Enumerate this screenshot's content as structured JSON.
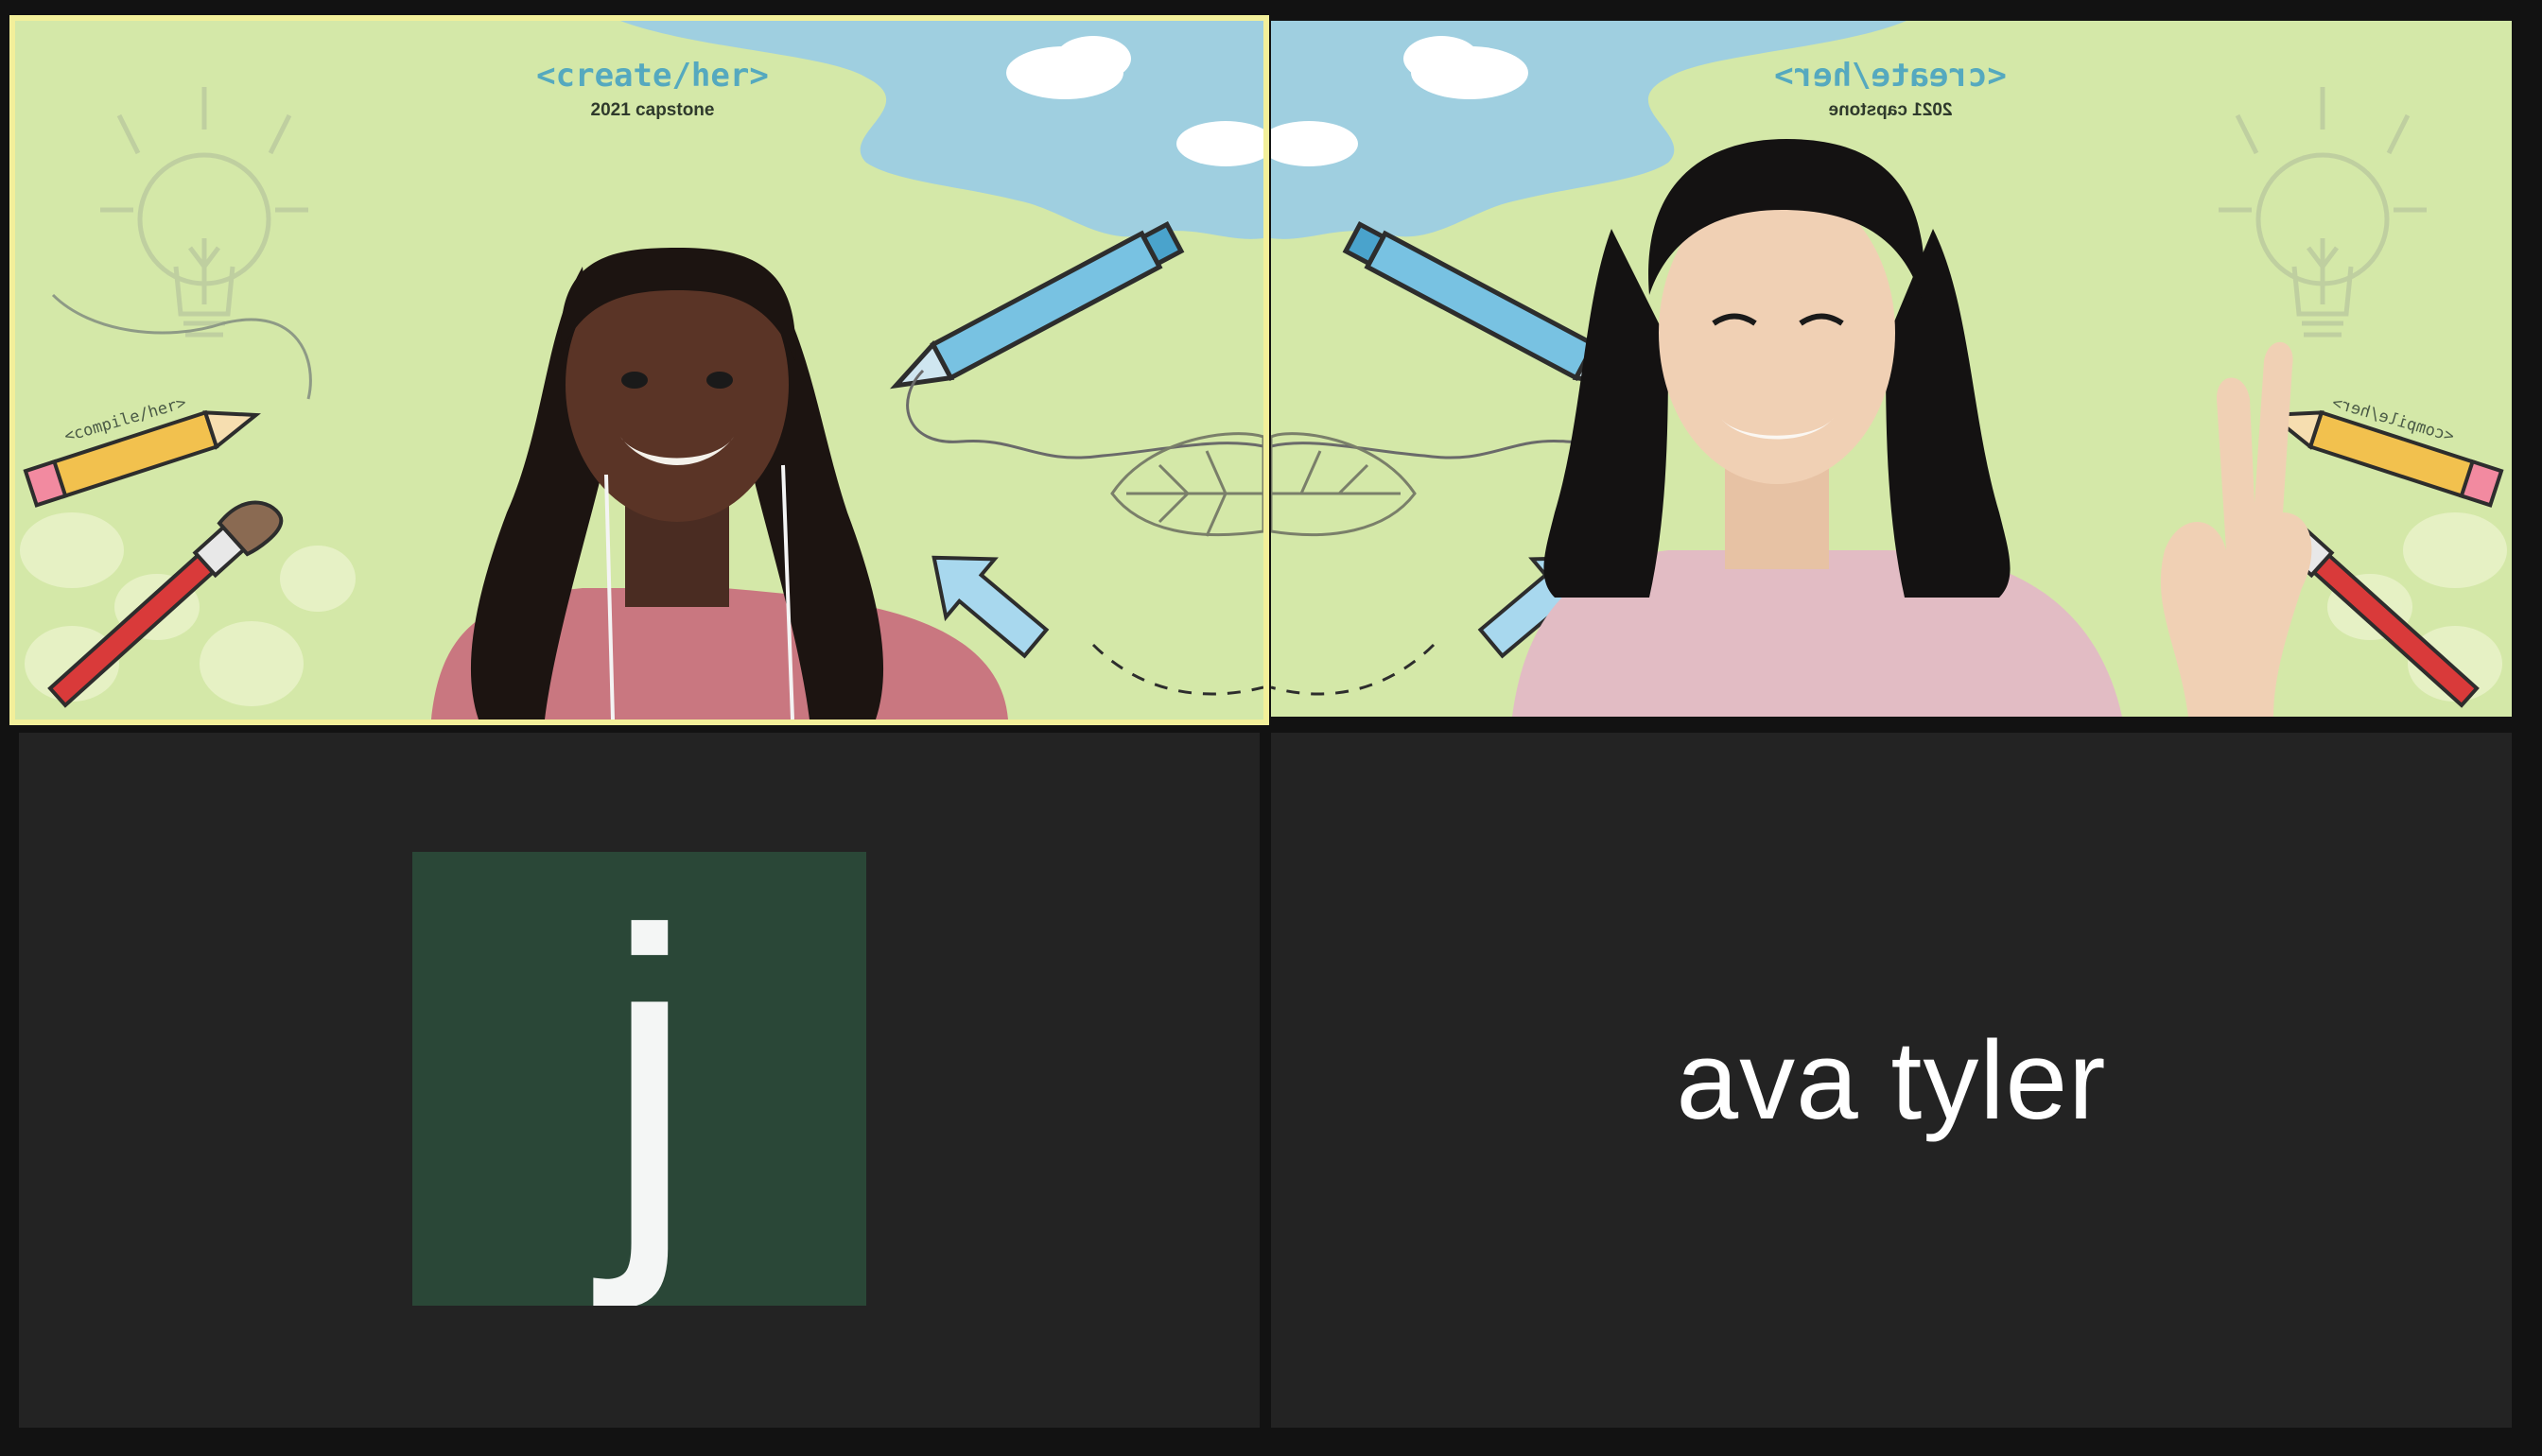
{
  "tiles": [
    {
      "id": "tile-1",
      "kind": "video",
      "active_speaker": true,
      "background": {
        "title": "<create/her>",
        "subtitle": "2021 capstone",
        "doodle_text": "<compile/her>",
        "mirrored": false
      }
    },
    {
      "id": "tile-2",
      "kind": "video",
      "active_speaker": false,
      "background": {
        "title": "<create/her>",
        "subtitle": "2021 capstone",
        "doodle_text": "<compile/her>",
        "mirrored": true
      }
    },
    {
      "id": "tile-3",
      "kind": "avatar",
      "avatar_letter": "j",
      "avatar_color": "#2a4737"
    },
    {
      "id": "tile-4",
      "kind": "name",
      "name": "ava tyler"
    }
  ],
  "colors": {
    "window_bg": "#121212",
    "tile_bg": "#232323",
    "active_border": "#f2ef9a",
    "vbg_green": "#d4e8a8",
    "vbg_sky": "#9fcfe0",
    "title_teal": "#55a9bf"
  }
}
